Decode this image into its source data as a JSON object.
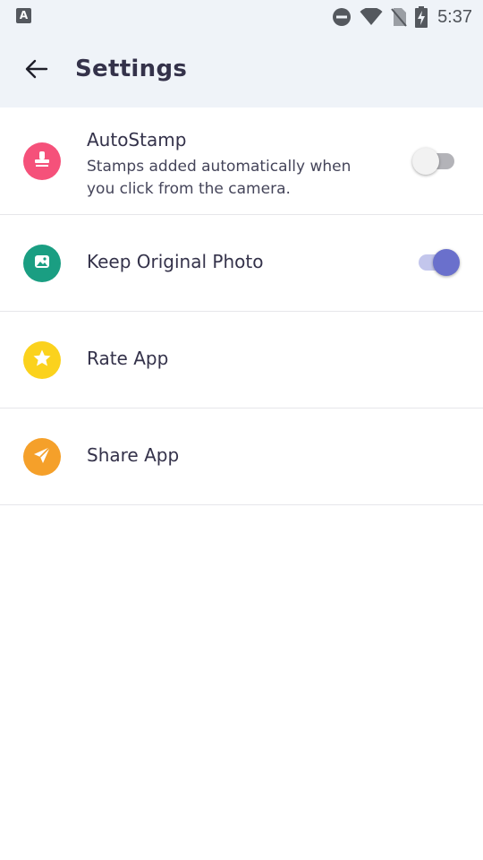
{
  "status_bar": {
    "notification_icon": "A",
    "icons": [
      "do-not-disturb-icon",
      "wifi-icon",
      "no-sim-icon",
      "battery-charging-icon"
    ],
    "time": "5:37"
  },
  "header": {
    "back_icon": "arrow-left-icon",
    "title": "Settings"
  },
  "settings": {
    "autostamp": {
      "title": "AutoStamp",
      "description": "Stamps added automatically when you click from the camera.",
      "icon": "stamp-icon",
      "icon_color": "#f5517a",
      "enabled": false
    },
    "keep_original": {
      "title": "Keep Original Photo",
      "icon": "photo-icon",
      "icon_color": "#1a9e82",
      "enabled": true
    },
    "rate_app": {
      "title": "Rate App",
      "icon": "star-icon",
      "icon_color": "#fbd21d"
    },
    "share_app": {
      "title": "Share App",
      "icon": "send-icon",
      "icon_color": "#f5a02a"
    }
  },
  "colors": {
    "header_bg": "#eff3f8",
    "toggle_on_knob": "#6a70cc",
    "toggle_on_track": "#c3c6ec",
    "toggle_off_knob": "#f2f2f2",
    "toggle_off_track": "#b3b3b8",
    "divider": "#e6e6ea"
  }
}
